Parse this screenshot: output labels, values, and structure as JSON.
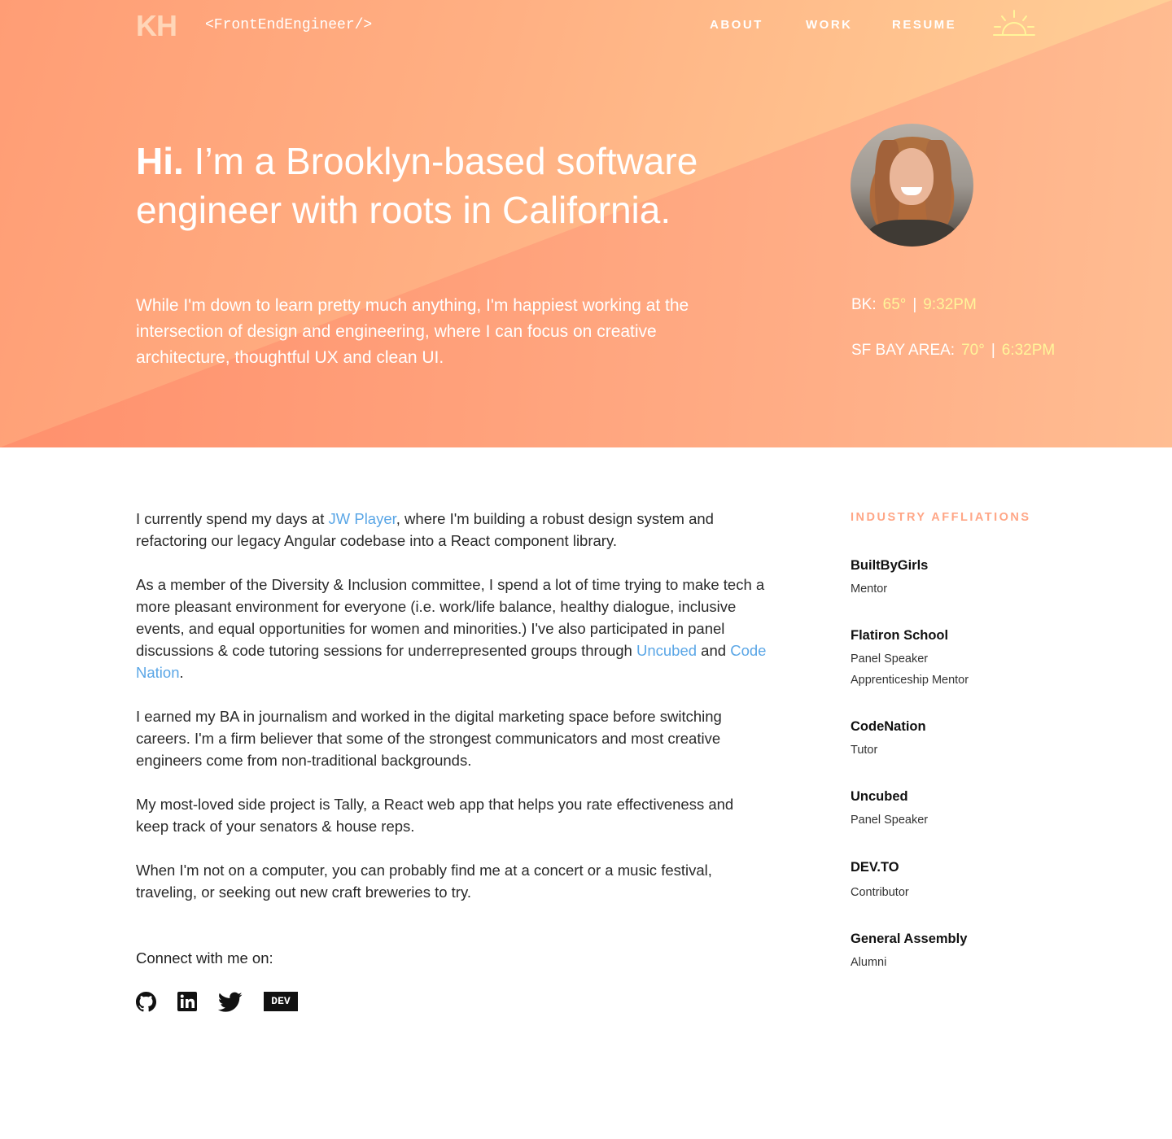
{
  "nav": {
    "logo": "KH",
    "tagline": "<FrontEndEngineer/>",
    "links": [
      "ABOUT",
      "WORK",
      "RESUME"
    ],
    "theme_icon": "sunrise-icon"
  },
  "hero": {
    "greeting": "Hi.",
    "headline": " I’m a Brooklyn-based software engineer with roots in California.",
    "intro": "While I'm down to learn pretty much anything, I'm happiest working at the intersection of design and engineering, where I can focus on creative architecture, thoughtful UX and clean UI.",
    "weather": {
      "bk": {
        "label": "BK:",
        "temp": "65°",
        "time": "9:32PM"
      },
      "sf": {
        "label": "SF BAY AREA:",
        "temp": "70°",
        "time": "6:32PM"
      },
      "separator": "|"
    }
  },
  "bio": {
    "p1_before": "I currently spend my days at ",
    "p1_link": "JW Player",
    "p1_after": ", where I'm building a robust design system and refactoring our legacy Angular codebase into a React component library.",
    "p2_before": "As a member of the Diversity & Inclusion committee, I spend a lot of time trying to make tech a more pleasant environment for everyone (i.e. work/life balance, healthy dialogue, inclusive events, and equal opportunities for women and minorities.) I've also participated in panel discussions & code tutoring sessions for underrepresented groups through ",
    "p2_link1": "Uncubed",
    "p2_mid": " and ",
    "p2_link2": "Code Nation",
    "p2_after": ".",
    "p3": "I earned my BA in journalism and worked in the digital marketing space before switching careers. I'm a firm believer that some of the strongest communicators and most creative engineers come from non-traditional backgrounds.",
    "p4": "My most-loved side project is Tally, a React web app that helps you rate effectiveness and keep track of your senators & house reps.",
    "p5": "When I'm not on a computer, you can probably find me at a concert or a music festival, traveling, or seeking out new craft breweries to try."
  },
  "connect": {
    "title": "Connect with me on:",
    "icons": [
      "github-icon",
      "linkedin-icon",
      "twitter-icon",
      "dev-icon"
    ],
    "dev_label": "DEV"
  },
  "affiliations": {
    "title": "INDUSTRY AFFLIATIONS",
    "items": [
      {
        "org": "BuiltByGirls",
        "roles": [
          "Mentor"
        ]
      },
      {
        "org": "Flatiron School",
        "roles": [
          "Panel Speaker",
          "Apprenticeship Mentor"
        ]
      },
      {
        "org": "CodeNation",
        "roles": [
          "Tutor"
        ]
      },
      {
        "org": "Uncubed",
        "roles": [
          "Panel Speaker"
        ]
      },
      {
        "org": "DEV.TO",
        "roles": [
          "Contributor"
        ]
      },
      {
        "org": "General Assembly",
        "roles": [
          "Alumni"
        ]
      }
    ]
  },
  "colors": {
    "hero_gradient_start": "#ff8f6c",
    "hero_gradient_end": "#ffd49a",
    "weather_value": "#fff59a",
    "link": "#5aa6e6",
    "aff_title": "#ffa686"
  }
}
